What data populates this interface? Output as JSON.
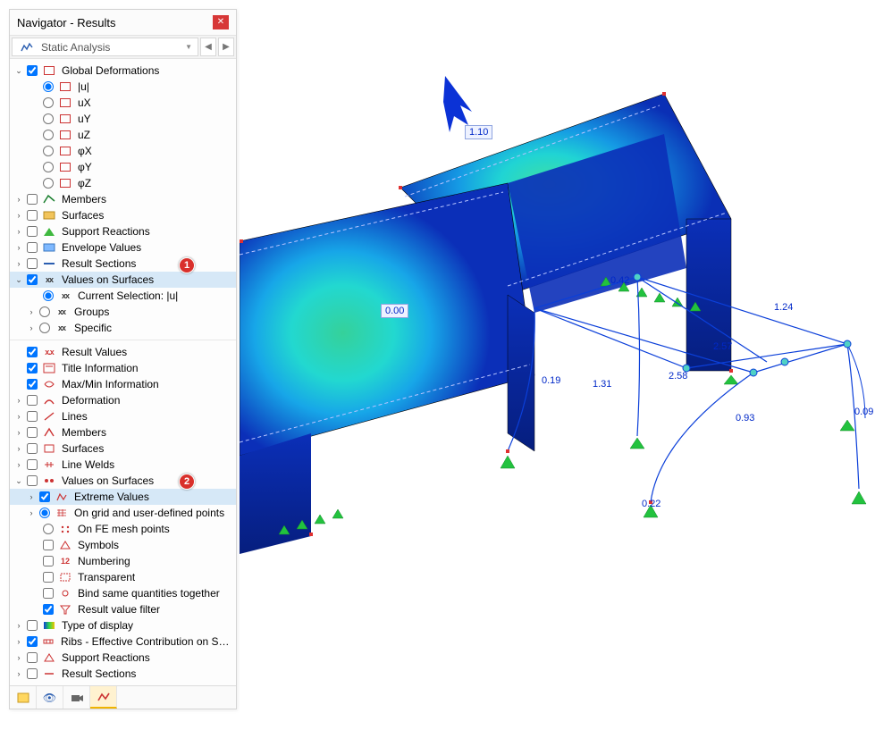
{
  "panel": {
    "title": "Navigator - Results",
    "dropdown": "Static Analysis"
  },
  "tree1": {
    "globalDeformations": "Global Deformations",
    "u_abs": "|u|",
    "ux": "uX",
    "uy": "uY",
    "uz": "uZ",
    "phix": "φX",
    "phiy": "φY",
    "phiz": "φZ",
    "members": "Members",
    "surfaces": "Surfaces",
    "supportReactions": "Support Reactions",
    "envelopeValues": "Envelope Values",
    "resultSections": "Result Sections",
    "valuesOnSurfaces": "Values on Surfaces",
    "currentSelection": "Current Selection: |u|",
    "groups": "Groups",
    "specific": "Specific"
  },
  "tree2": {
    "resultValues": "Result Values",
    "titleInfo": "Title Information",
    "maxMinInfo": "Max/Min Information",
    "deformation": "Deformation",
    "lines": "Lines",
    "members": "Members",
    "surfaces": "Surfaces",
    "lineWelds": "Line Welds",
    "valuesOnSurfaces": "Values on Surfaces",
    "extremeValues": "Extreme Values",
    "onGrid": "On grid and user-defined points",
    "onFE": "On FE mesh points",
    "symbols": "Symbols",
    "numbering": "Numbering",
    "transparent": "Transparent",
    "bindSame": "Bind same quantities together",
    "resultValueFilter": "Result value filter",
    "typeOfDisplay": "Type of display",
    "ribs": "Ribs - Effective Contribution on Sur...",
    "supportReactions": "Support Reactions",
    "resultSections": "Result Sections"
  },
  "badges": {
    "b1": "1",
    "b2": "2"
  },
  "viewport": {
    "val_110": "1.10",
    "val_000": "0.00",
    "val_042": "0.42",
    "val_124": "1.24",
    "val_257": "2.57",
    "val_258": "2.58",
    "val_131": "1.31",
    "val_019": "0.19",
    "val_093": "0.93",
    "val_009": "0.09",
    "val_022": "0.22"
  }
}
